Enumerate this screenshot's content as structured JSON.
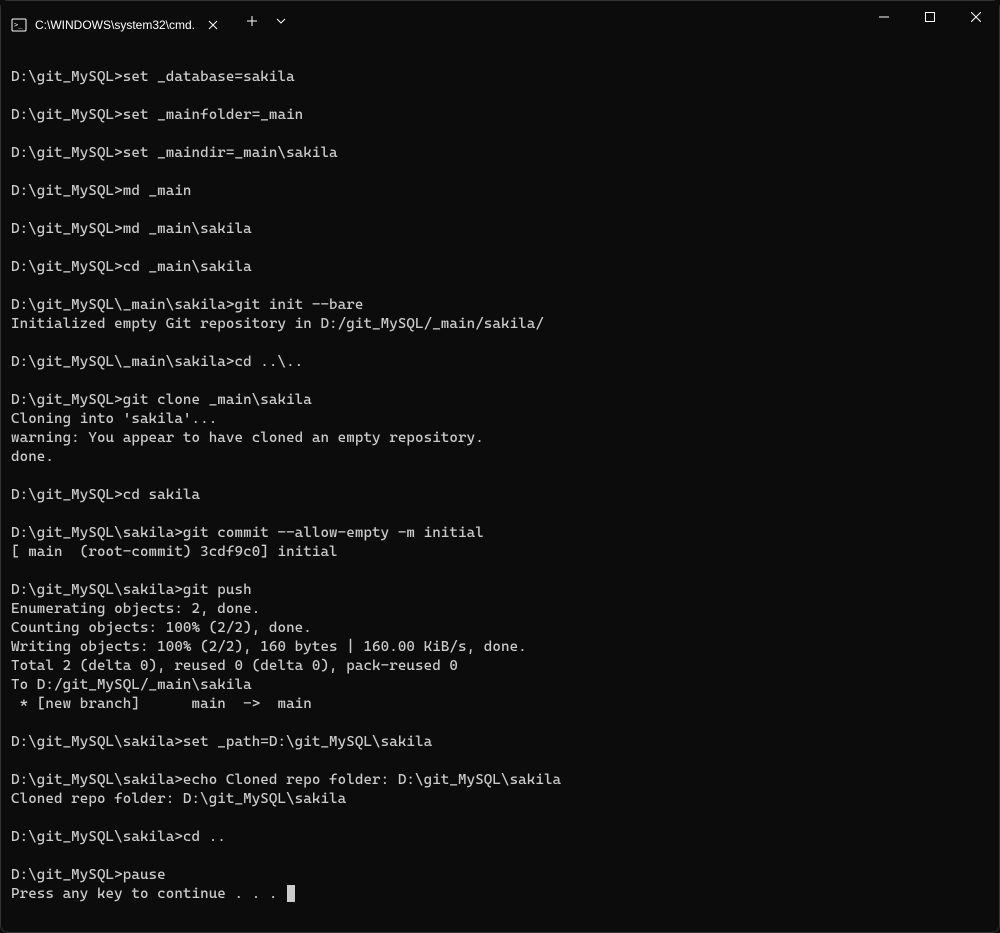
{
  "titlebar": {
    "tab": {
      "title": "C:\\WINDOWS\\system32\\cmd."
    }
  },
  "terminal": {
    "lines": [
      "",
      "D:\\git_MySQL>set _database=sakila",
      "",
      "D:\\git_MySQL>set _mainfolder=_main",
      "",
      "D:\\git_MySQL>set _maindir=_main\\sakila",
      "",
      "D:\\git_MySQL>md _main",
      "",
      "D:\\git_MySQL>md _main\\sakila",
      "",
      "D:\\git_MySQL>cd _main\\sakila",
      "",
      "D:\\git_MySQL\\_main\\sakila>git init --bare",
      "Initialized empty Git repository in D:/git_MySQL/_main/sakila/",
      "",
      "D:\\git_MySQL\\_main\\sakila>cd ..\\..",
      "",
      "D:\\git_MySQL>git clone _main\\sakila",
      "Cloning into 'sakila'...",
      "warning: You appear to have cloned an empty repository.",
      "done.",
      "",
      "D:\\git_MySQL>cd sakila",
      "",
      "D:\\git_MySQL\\sakila>git commit --allow-empty -m initial",
      "[ main  (root-commit) 3cdf9c0] initial",
      "",
      "D:\\git_MySQL\\sakila>git push",
      "Enumerating objects: 2, done.",
      "Counting objects: 100% (2/2), done.",
      "Writing objects: 100% (2/2), 160 bytes | 160.00 KiB/s, done.",
      "Total 2 (delta 0), reused 0 (delta 0), pack-reused 0",
      "To D:/git_MySQL/_main\\sakila",
      " * [new branch]      main  ->  main",
      "",
      "D:\\git_MySQL\\sakila>set _path=D:\\git_MySQL\\sakila",
      "",
      "D:\\git_MySQL\\sakila>echo Cloned repo folder: D:\\git_MySQL\\sakila",
      "Cloned repo folder: D:\\git_MySQL\\sakila",
      "",
      "D:\\git_MySQL\\sakila>cd ..",
      "",
      "D:\\git_MySQL>pause",
      "Press any key to continue . . . "
    ]
  }
}
